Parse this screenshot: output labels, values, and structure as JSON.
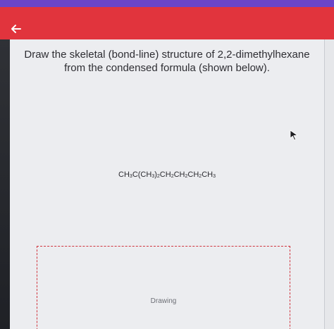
{
  "header": {
    "back_icon": "arrow-left-icon",
    "accent_color": "#e1343d",
    "top_strip_color": "#6a45c9"
  },
  "question": {
    "line1": "Draw the skeletal (bond-line) structure of 2,2-dimethylhexane",
    "line2": "from the condensed formula (shown below)."
  },
  "formula": {
    "parts": [
      "CH",
      "3",
      "C(CH",
      "3",
      ")",
      "2",
      "CH",
      "2",
      "CH",
      "2",
      "CH",
      "2",
      "CH",
      "3"
    ]
  },
  "drawing": {
    "label": "Drawing"
  }
}
